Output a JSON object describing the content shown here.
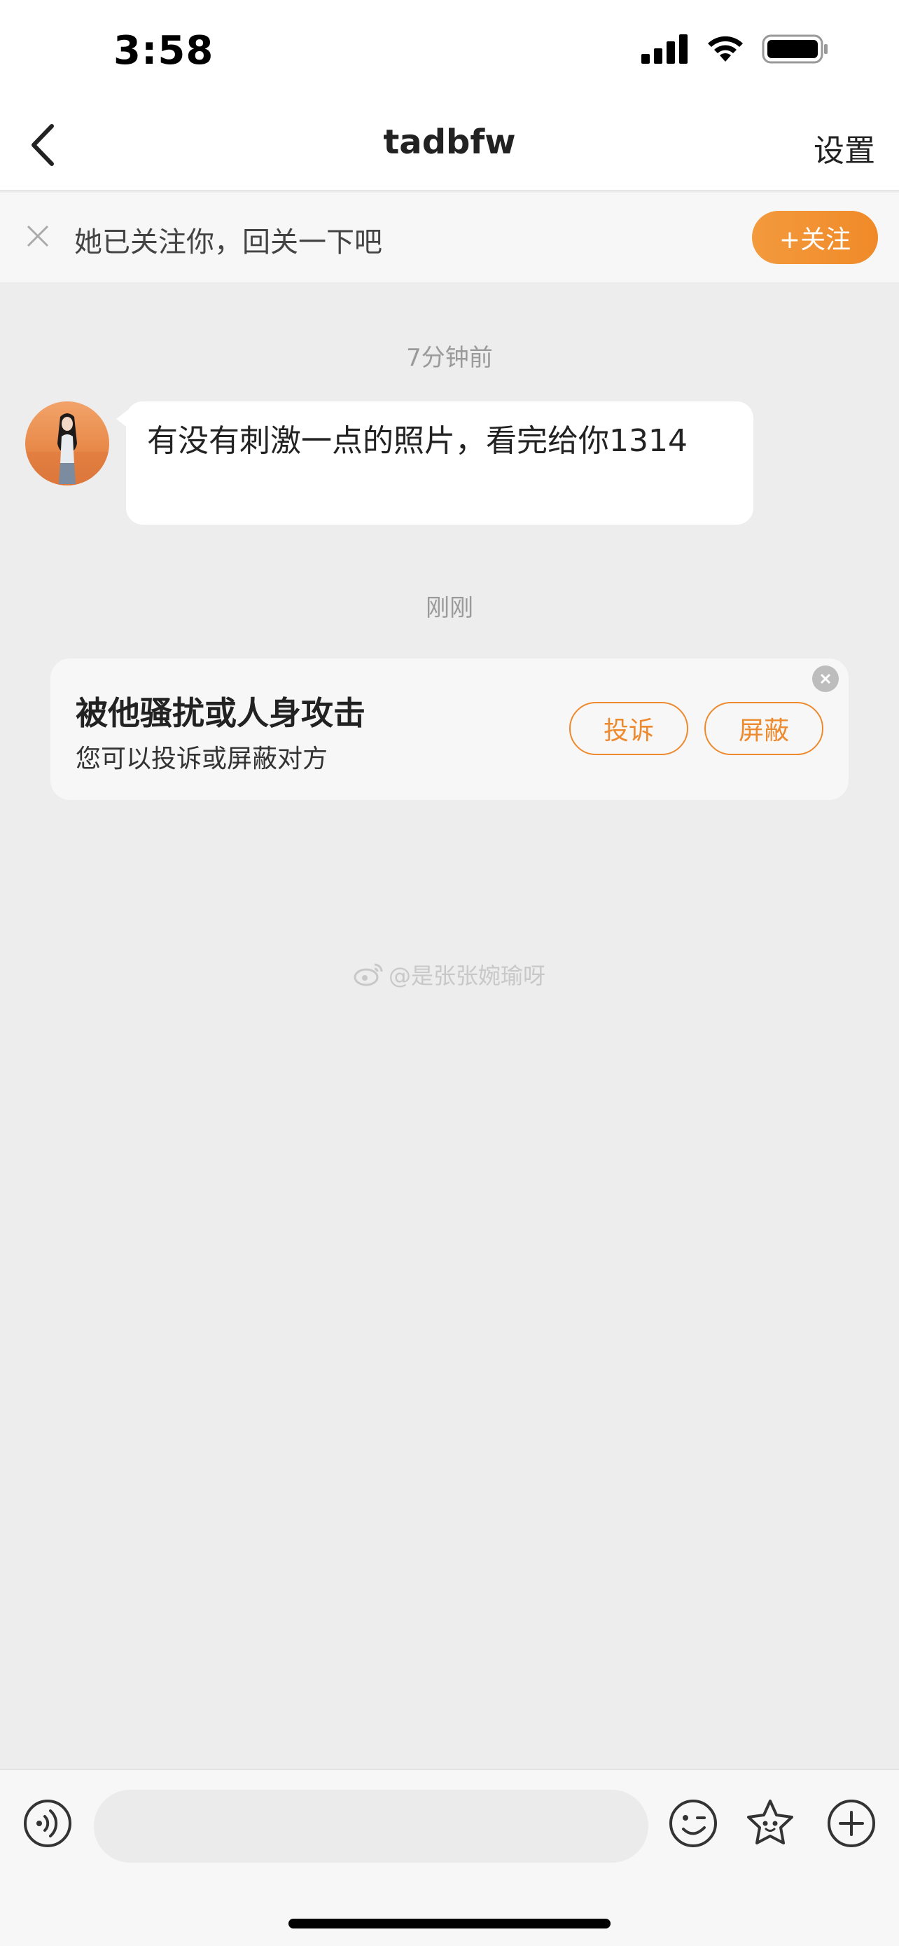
{
  "status_bar": {
    "time": "3:58"
  },
  "nav": {
    "title": "tadbfw",
    "settings_label": "设置"
  },
  "follow_banner": {
    "text": "她已关注你，回关一下吧",
    "follow_label": "+关注"
  },
  "messages": [
    {
      "timestamp": "7分钟前",
      "text": "有没有刺激一点的照片，看完给你1314"
    }
  ],
  "notice": {
    "timestamp": "刚刚",
    "title": "被他骚扰或人身攻击",
    "subtitle": "您可以投诉或屏蔽对方",
    "report_label": "投诉",
    "block_label": "屏蔽"
  },
  "watermark": "@是张张婉瑜呀",
  "input_bar": {
    "placeholder": ""
  },
  "colors": {
    "accent": "#f08a28",
    "background": "#ededed"
  },
  "icons": [
    "back-icon",
    "close-icon",
    "voice-icon",
    "emoji-icon",
    "sticker-icon",
    "plus-icon",
    "weibo-icon",
    "signal-icon",
    "wifi-icon",
    "battery-icon"
  ]
}
